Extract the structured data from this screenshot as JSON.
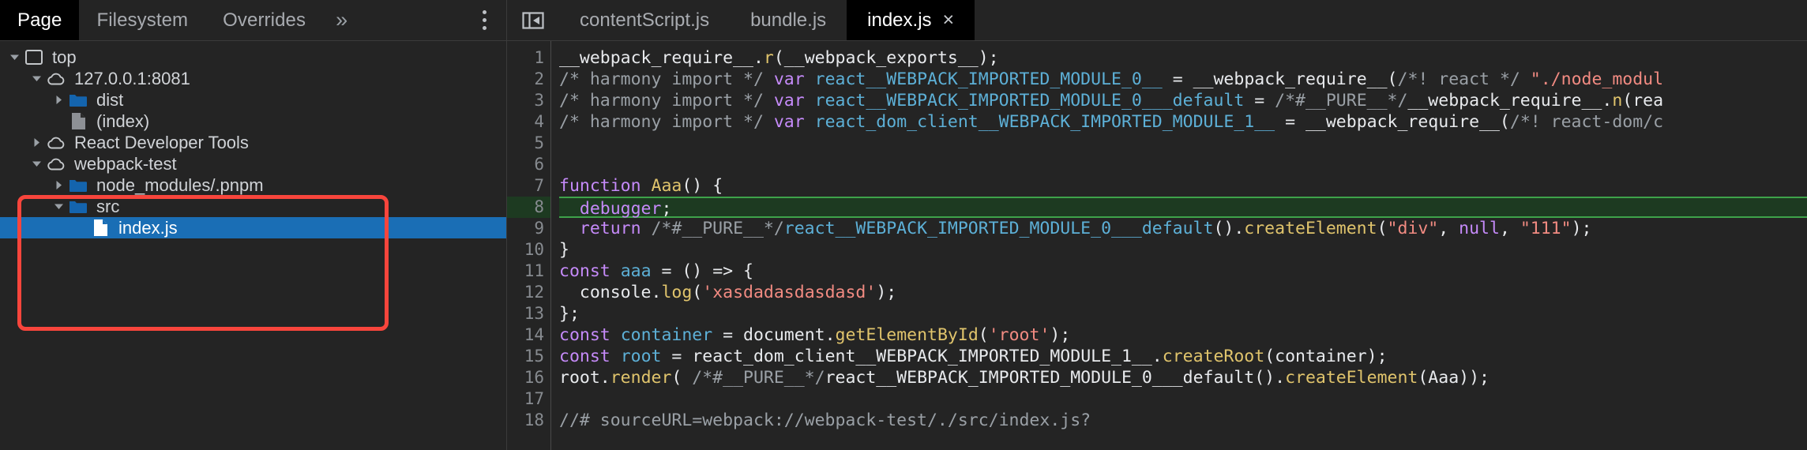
{
  "navigator": {
    "tabs": [
      {
        "label": "Page",
        "selected": true
      },
      {
        "label": "Filesystem",
        "selected": false
      },
      {
        "label": "Overrides",
        "selected": false
      }
    ],
    "more_label": "»",
    "menu_label": "more-options",
    "tree": [
      {
        "label": "top",
        "icon": "frame-icon",
        "twist": "open",
        "indent": 0,
        "selected": false
      },
      {
        "label": "127.0.0.1:8081",
        "icon": "cloud-icon",
        "twist": "open",
        "indent": 1,
        "selected": false
      },
      {
        "label": "dist",
        "icon": "folder-icon",
        "twist": "closed",
        "indent": 2,
        "selected": false
      },
      {
        "label": "(index)",
        "icon": "document-icon",
        "twist": "none",
        "indent": 2,
        "selected": false
      },
      {
        "label": "React Developer Tools",
        "icon": "cloud-icon",
        "twist": "closed",
        "indent": 1,
        "selected": false
      },
      {
        "label": "webpack-test",
        "icon": "cloud-icon",
        "twist": "open",
        "indent": 1,
        "selected": false
      },
      {
        "label": "node_modules/.pnpm",
        "icon": "folder-icon",
        "twist": "closed",
        "indent": 2,
        "selected": false
      },
      {
        "label": "src",
        "icon": "folder-icon",
        "twist": "open",
        "indent": 2,
        "selected": false
      },
      {
        "label": "index.js",
        "icon": "js-file-icon",
        "twist": "none",
        "indent": 3,
        "selected": true
      }
    ],
    "annotation_color": "#f8453c"
  },
  "editor": {
    "collapse_icon": "collapse-sidebar-icon",
    "tabs": [
      {
        "label": "contentScript.js",
        "active": false,
        "closable": false
      },
      {
        "label": "bundle.js",
        "active": false,
        "closable": false
      },
      {
        "label": "index.js",
        "active": true,
        "closable": true,
        "close_label": "×"
      }
    ],
    "line_numbers": [
      "1",
      "2",
      "3",
      "4",
      "5",
      "6",
      "7",
      "8",
      "9",
      "10",
      "11",
      "12",
      "13",
      "14",
      "15",
      "16",
      "17",
      "18"
    ],
    "execution_line": 8,
    "lines": [
      {
        "n": 1,
        "tokens": [
          {
            "t": "__webpack_require__",
            "c": "t-plain"
          },
          {
            "t": ".",
            "c": "t-op"
          },
          {
            "t": "r",
            "c": "t-fn"
          },
          {
            "t": "(__webpack_exports__);",
            "c": "t-plain"
          }
        ]
      },
      {
        "n": 2,
        "tokens": [
          {
            "t": "/* harmony import */",
            "c": "t-comment"
          },
          {
            "t": " ",
            "c": "t-plain"
          },
          {
            "t": "var",
            "c": "t-kw"
          },
          {
            "t": " ",
            "c": "t-plain"
          },
          {
            "t": "react__WEBPACK_IMPORTED_MODULE_0__",
            "c": "t-var"
          },
          {
            "t": " = ",
            "c": "t-plain"
          },
          {
            "t": "__webpack_require__",
            "c": "t-plain"
          },
          {
            "t": "(",
            "c": "t-plain"
          },
          {
            "t": "/*! react */",
            "c": "t-comment"
          },
          {
            "t": " ",
            "c": "t-plain"
          },
          {
            "t": "\"./node_modul",
            "c": "t-str"
          }
        ]
      },
      {
        "n": 3,
        "tokens": [
          {
            "t": "/* harmony import */",
            "c": "t-comment"
          },
          {
            "t": " ",
            "c": "t-plain"
          },
          {
            "t": "var",
            "c": "t-kw"
          },
          {
            "t": " ",
            "c": "t-plain"
          },
          {
            "t": "react__WEBPACK_IMPORTED_MODULE_0___default",
            "c": "t-var"
          },
          {
            "t": " = ",
            "c": "t-plain"
          },
          {
            "t": "/*#__PURE__*/",
            "c": "t-comment"
          },
          {
            "t": "__webpack_require__",
            "c": "t-plain"
          },
          {
            "t": ".",
            "c": "t-op"
          },
          {
            "t": "n",
            "c": "t-fn"
          },
          {
            "t": "(rea",
            "c": "t-plain"
          }
        ]
      },
      {
        "n": 4,
        "tokens": [
          {
            "t": "/* harmony import */",
            "c": "t-comment"
          },
          {
            "t": " ",
            "c": "t-plain"
          },
          {
            "t": "var",
            "c": "t-kw"
          },
          {
            "t": " ",
            "c": "t-plain"
          },
          {
            "t": "react_dom_client__WEBPACK_IMPORTED_MODULE_1__",
            "c": "t-var"
          },
          {
            "t": " = ",
            "c": "t-plain"
          },
          {
            "t": "__webpack_require__",
            "c": "t-plain"
          },
          {
            "t": "(",
            "c": "t-plain"
          },
          {
            "t": "/*! react-dom/c",
            "c": "t-comment"
          }
        ]
      },
      {
        "n": 5,
        "tokens": []
      },
      {
        "n": 6,
        "tokens": []
      },
      {
        "n": 7,
        "tokens": [
          {
            "t": "function",
            "c": "t-kw"
          },
          {
            "t": " ",
            "c": "t-plain"
          },
          {
            "t": "Aaa",
            "c": "t-fn"
          },
          {
            "t": "() {",
            "c": "t-plain"
          }
        ]
      },
      {
        "n": 8,
        "tokens": [
          {
            "t": "  ",
            "c": "t-plain"
          },
          {
            "t": "debugger",
            "c": "t-kw"
          },
          {
            "t": ";",
            "c": "t-plain"
          }
        ]
      },
      {
        "n": 9,
        "tokens": [
          {
            "t": "  ",
            "c": "t-plain"
          },
          {
            "t": "return",
            "c": "t-kw"
          },
          {
            "t": " ",
            "c": "t-plain"
          },
          {
            "t": "/*#__PURE__*/",
            "c": "t-comment"
          },
          {
            "t": "react__WEBPACK_IMPORTED_MODULE_0___default",
            "c": "t-var"
          },
          {
            "t": "()",
            "c": "t-plain"
          },
          {
            "t": ".",
            "c": "t-op"
          },
          {
            "t": "createElement",
            "c": "t-fn"
          },
          {
            "t": "(",
            "c": "t-plain"
          },
          {
            "t": "\"div\"",
            "c": "t-str"
          },
          {
            "t": ", ",
            "c": "t-plain"
          },
          {
            "t": "null",
            "c": "t-kw"
          },
          {
            "t": ", ",
            "c": "t-plain"
          },
          {
            "t": "\"111\"",
            "c": "t-str"
          },
          {
            "t": ");",
            "c": "t-plain"
          }
        ]
      },
      {
        "n": 10,
        "tokens": [
          {
            "t": "}",
            "c": "t-plain"
          }
        ]
      },
      {
        "n": 11,
        "tokens": [
          {
            "t": "const",
            "c": "t-kw"
          },
          {
            "t": " ",
            "c": "t-plain"
          },
          {
            "t": "aaa",
            "c": "t-var"
          },
          {
            "t": " = () => {",
            "c": "t-plain"
          }
        ]
      },
      {
        "n": 12,
        "tokens": [
          {
            "t": "  ",
            "c": "t-plain"
          },
          {
            "t": "console",
            "c": "t-plain"
          },
          {
            "t": ".",
            "c": "t-op"
          },
          {
            "t": "log",
            "c": "t-fn"
          },
          {
            "t": "(",
            "c": "t-plain"
          },
          {
            "t": "'xasdadasdasdasd'",
            "c": "t-str"
          },
          {
            "t": ");",
            "c": "t-plain"
          }
        ]
      },
      {
        "n": 13,
        "tokens": [
          {
            "t": "};",
            "c": "t-plain"
          }
        ]
      },
      {
        "n": 14,
        "tokens": [
          {
            "t": "const",
            "c": "t-kw"
          },
          {
            "t": " ",
            "c": "t-plain"
          },
          {
            "t": "container",
            "c": "t-var"
          },
          {
            "t": " = ",
            "c": "t-plain"
          },
          {
            "t": "document",
            "c": "t-plain"
          },
          {
            "t": ".",
            "c": "t-op"
          },
          {
            "t": "getElementById",
            "c": "t-fn"
          },
          {
            "t": "(",
            "c": "t-plain"
          },
          {
            "t": "'root'",
            "c": "t-str"
          },
          {
            "t": ");",
            "c": "t-plain"
          }
        ]
      },
      {
        "n": 15,
        "tokens": [
          {
            "t": "const",
            "c": "t-kw"
          },
          {
            "t": " ",
            "c": "t-plain"
          },
          {
            "t": "root",
            "c": "t-var"
          },
          {
            "t": " = ",
            "c": "t-plain"
          },
          {
            "t": "react_dom_client__WEBPACK_IMPORTED_MODULE_1__",
            "c": "t-plain"
          },
          {
            "t": ".",
            "c": "t-op"
          },
          {
            "t": "createRoot",
            "c": "t-fn"
          },
          {
            "t": "(container);",
            "c": "t-plain"
          }
        ]
      },
      {
        "n": 16,
        "tokens": [
          {
            "t": "root",
            "c": "t-plain"
          },
          {
            "t": ".",
            "c": "t-op"
          },
          {
            "t": "render",
            "c": "t-fn"
          },
          {
            "t": "( ",
            "c": "t-plain"
          },
          {
            "t": "/*#__PURE__*/",
            "c": "t-comment"
          },
          {
            "t": "react__WEBPACK_IMPORTED_MODULE_0___default",
            "c": "t-plain"
          },
          {
            "t": "()",
            "c": "t-plain"
          },
          {
            "t": ".",
            "c": "t-op"
          },
          {
            "t": "createElement",
            "c": "t-fn"
          },
          {
            "t": "(Aaa));",
            "c": "t-plain"
          }
        ]
      },
      {
        "n": 17,
        "tokens": []
      },
      {
        "n": 18,
        "tokens": [
          {
            "t": "//# sourceURL=webpack://webpack-test/./src/index.js?",
            "c": "t-comment"
          }
        ]
      }
    ]
  }
}
